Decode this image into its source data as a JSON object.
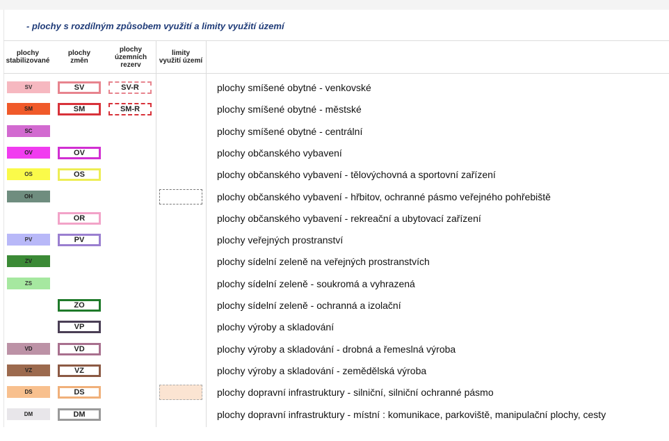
{
  "title": "- plochy s rozdílným způsobem využití a limity využití území",
  "headers": {
    "stabilized": "plochy\nstabilizované",
    "changes": "plochy\nzměn",
    "reserves": "plochy\núzemních\nrezerv",
    "limits": "limity\nvyužití území"
  },
  "rows": [
    {
      "stab": {
        "code": "SV",
        "color": "#f6b8c0",
        "text_color": "#333"
      },
      "change": {
        "code": "SV",
        "border": "#e7848e"
      },
      "reserve": {
        "code": "SV-R",
        "border": "#e7848e"
      },
      "limit": null,
      "desc": "plochy smíšené obytné - venkovské"
    },
    {
      "stab": {
        "code": "SM",
        "color": "#f05a2a",
        "text_color": "#222"
      },
      "change": {
        "code": "SM",
        "border": "#d8323a"
      },
      "reserve": {
        "code": "SM-R",
        "border": "#d8323a"
      },
      "limit": null,
      "desc": "plochy smíšené obytné - městské"
    },
    {
      "stab": {
        "code": "SC",
        "color": "#d26ad0",
        "text_color": "#222"
      },
      "change": null,
      "reserve": null,
      "limit": null,
      "desc": "plochy smíšené obytné - centrální"
    },
    {
      "stab": {
        "code": "OV",
        "color": "#f13cf0",
        "text_color": "#222"
      },
      "change": {
        "code": "OV",
        "border": "#d12fd2"
      },
      "reserve": null,
      "limit": null,
      "desc": "plochy občanského vybavení"
    },
    {
      "stab": {
        "code": "OS",
        "color": "#fafa4a",
        "text_color": "#333"
      },
      "change": {
        "code": "OS",
        "border": "#eded55"
      },
      "reserve": null,
      "limit": null,
      "desc": "plochy občanského vybavení - tělovýchovná a sportovní zařízení"
    },
    {
      "stab": {
        "code": "OH",
        "color": "#6f8d7f",
        "text_color": "#222"
      },
      "change": null,
      "reserve": null,
      "limit": {
        "fill": "#ffffff",
        "border": "#777"
      },
      "desc": "plochy občanského vybavení - hřbitov, ochranné pásmo veřejného pohřebiště"
    },
    {
      "stab": null,
      "change": {
        "code": "OR",
        "border": "#f2a3c8"
      },
      "reserve": null,
      "limit": null,
      "desc": "plochy občanského vybavení - rekreační a ubytovací zařízení"
    },
    {
      "stab": {
        "code": "PV",
        "color": "#b8b8f8",
        "text_color": "#333"
      },
      "change": {
        "code": "PV",
        "border": "#9a7fd0"
      },
      "reserve": null,
      "limit": null,
      "desc": "plochy veřejných prostranství"
    },
    {
      "stab": {
        "code": "ZV",
        "color": "#3b8a36",
        "text_color": "#222"
      },
      "change": null,
      "reserve": null,
      "limit": null,
      "desc": "plochy sídelní zeleně na veřejných prostranstvích"
    },
    {
      "stab": {
        "code": "ZS",
        "color": "#a6e8a0",
        "text_color": "#333"
      },
      "change": null,
      "reserve": null,
      "limit": null,
      "desc": "plochy sídelní zeleně - soukromá a vyhrazená"
    },
    {
      "stab": null,
      "change": {
        "code": "ZO",
        "border": "#1f7a2a"
      },
      "reserve": null,
      "limit": null,
      "desc": "plochy sídelní zeleně - ochranná a izolační"
    },
    {
      "stab": null,
      "change": {
        "code": "VP",
        "border": "#4a3f55"
      },
      "reserve": null,
      "limit": null,
      "desc": "plochy výroby a skladování"
    },
    {
      "stab": {
        "code": "VD",
        "color": "#bc92a6",
        "text_color": "#222"
      },
      "change": {
        "code": "VD",
        "border": "#a8708e"
      },
      "reserve": null,
      "limit": null,
      "desc": "plochy výroby a skladování - drobná a řemeslná výroba"
    },
    {
      "stab": {
        "code": "VZ",
        "color": "#9c6a4e",
        "text_color": "#222"
      },
      "change": {
        "code": "VZ",
        "border": "#8c5a44"
      },
      "reserve": null,
      "limit": null,
      "desc": "plochy výroby a skladování - zemědělská výroba"
    },
    {
      "stab": {
        "code": "DS",
        "color": "#f8c08e",
        "text_color": "#222"
      },
      "change": {
        "code": "DS",
        "border": "#f0b07a"
      },
      "reserve": null,
      "limit": {
        "fill": "#fbe4d2",
        "border": "#aaa"
      },
      "desc": "plochy dopravní infrastruktury - silniční, silniční ochranné pásmo"
    },
    {
      "stab": {
        "code": "DM",
        "color": "#e8e6ea",
        "text_color": "#222"
      },
      "change": {
        "code": "DM",
        "border": "#9a9a9a"
      },
      "reserve": null,
      "limit": null,
      "desc": "plochy dopravní infrastruktury - místní : komunikace, parkoviště, manipulační plochy, cesty"
    }
  ]
}
